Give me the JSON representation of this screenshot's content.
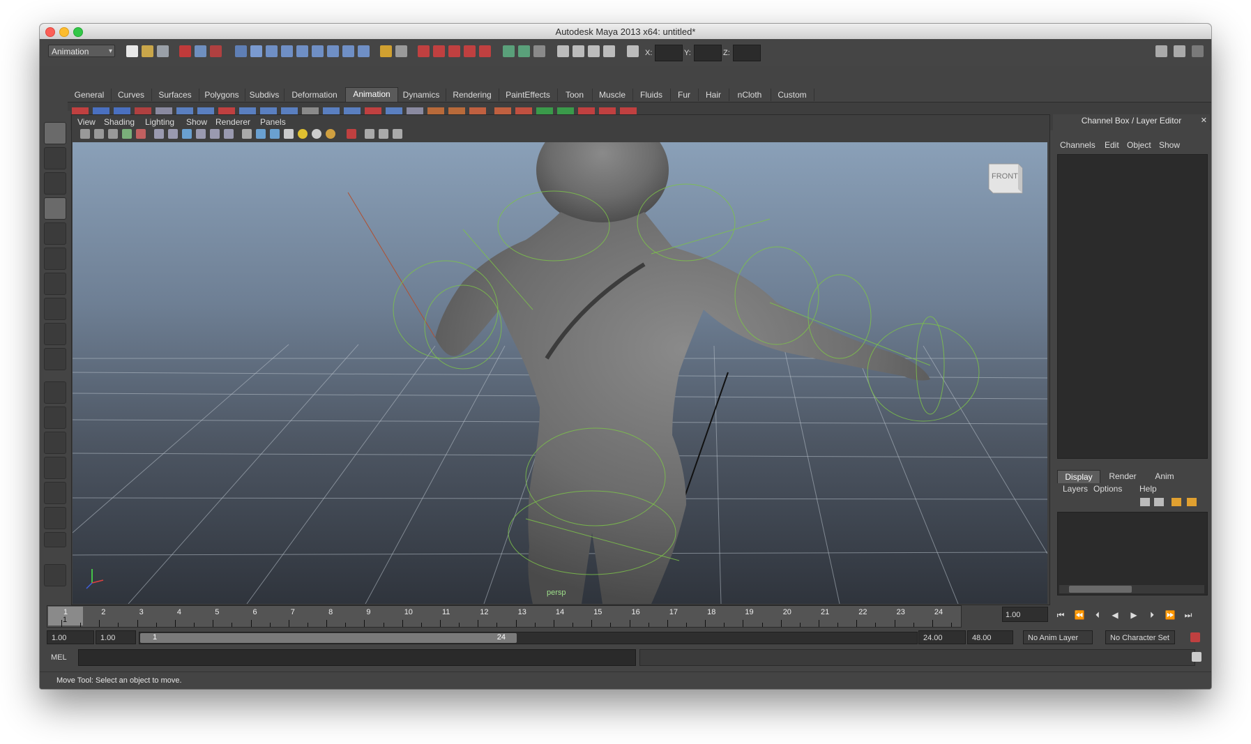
{
  "window": {
    "title": "Autodesk Maya 2013 x64: untitled*"
  },
  "status_line": {
    "mode": "Animation",
    "x_label": "X:",
    "y_label": "Y:",
    "z_label": "Z:"
  },
  "shelf": {
    "tabs": [
      "General",
      "Curves",
      "Surfaces",
      "Polygons",
      "Subdivs",
      "Deformation",
      "Animation",
      "Dynamics",
      "Rendering",
      "PaintEffects",
      "Toon",
      "Muscle",
      "Fluids",
      "Fur",
      "Hair",
      "nCloth",
      "Custom"
    ],
    "active_tab": "Animation"
  },
  "viewport": {
    "menu": [
      "View",
      "Shading",
      "Lighting",
      "Show",
      "Renderer",
      "Panels"
    ],
    "camera_label": "persp",
    "viewcube_label": "FRONT"
  },
  "channel_box": {
    "title": "Channel Box / Layer Editor",
    "menu": [
      "Channels",
      "Edit",
      "Object",
      "Show"
    ]
  },
  "layer_editor": {
    "tabs": [
      "Display",
      "Render",
      "Anim"
    ],
    "active_tab": "Display",
    "menu": [
      "Layers",
      "Options",
      "Help"
    ]
  },
  "time_slider": {
    "frames": [
      "1",
      "2",
      "3",
      "4",
      "5",
      "6",
      "7",
      "8",
      "9",
      "10",
      "11",
      "12",
      "13",
      "14",
      "15",
      "16",
      "17",
      "18",
      "19",
      "20",
      "21",
      "22",
      "23",
      "24"
    ],
    "current_frame_label": "1",
    "current_time": "1.00"
  },
  "range_slider": {
    "start_time": "1.00",
    "playback_start": "1.00",
    "range_start_label": "1",
    "range_end_label": "24",
    "playback_end": "24.00",
    "end_time": "48.00",
    "anim_layer": "No Anim Layer",
    "character_set": "No Character Set"
  },
  "command_line": {
    "label": "MEL"
  },
  "help_line": {
    "text": "Move Tool: Select an object to move."
  }
}
